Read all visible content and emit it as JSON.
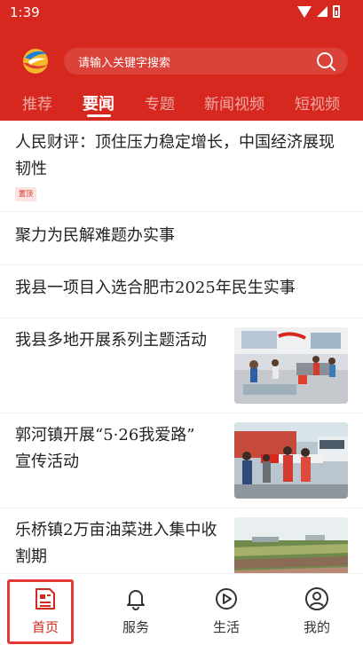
{
  "status_bar": {
    "time": "1:39"
  },
  "search": {
    "placeholder": "请输入关键字搜索"
  },
  "tabs": [
    {
      "label": "推荐"
    },
    {
      "label": "要闻",
      "active": true
    },
    {
      "label": "专题"
    },
    {
      "label": "新闻视频"
    },
    {
      "label": "短视频"
    }
  ],
  "news": [
    {
      "title_line1": "人民财评：顶住压力稳定增长，中国经济展现",
      "title_line2": "韧性",
      "badge": "置顶"
    },
    {
      "title_line1": "聚力为民解难题办实事"
    },
    {
      "title_line1": "我县一项目入选合肥市2025年民生实事"
    },
    {
      "title_line1": "我县多地开展系列主题活动",
      "thumbnail": "activity-photo"
    },
    {
      "title_line1": "郭河镇开展“5·26我爱路”",
      "title_line2": "宣传活动",
      "thumbnail": "roadshow-photo"
    },
    {
      "title_line1": "乐桥镇2万亩油菜进入集中收",
      "title_line2": "割期",
      "thumbnail": "rapeseed-field-photo"
    }
  ],
  "bottom_nav": [
    {
      "label": "首页",
      "icon": "news-icon",
      "active": true
    },
    {
      "label": "服务",
      "icon": "bell-icon"
    },
    {
      "label": "生活",
      "icon": "play-icon"
    },
    {
      "label": "我的",
      "icon": "user-icon"
    }
  ],
  "colors": {
    "brand": "#d6281f",
    "highlight": "#e53935"
  }
}
